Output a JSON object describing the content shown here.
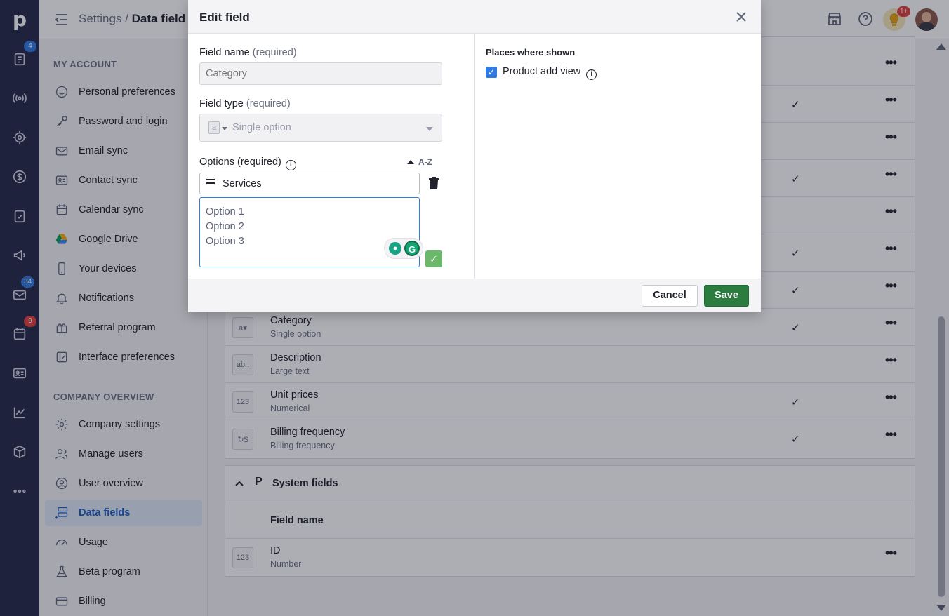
{
  "rail": {
    "logo": "p",
    "badges": {
      "deals": "4",
      "mail": "34",
      "activities": "9"
    },
    "colors": {
      "background": "#262847",
      "badge_blue": "#317ae2",
      "badge_red": "#e0403c"
    }
  },
  "header": {
    "breadcrumb_parent": "Settings",
    "breadcrumb_sep": " / ",
    "breadcrumb_current": "Data field",
    "notification_badge": "1+"
  },
  "sidebar": {
    "my_account_heading": "MY ACCOUNT",
    "my_account": [
      {
        "label": "Personal preferences",
        "icon": "smile-icon"
      },
      {
        "label": "Password and login",
        "icon": "key-icon"
      },
      {
        "label": "Email sync",
        "icon": "mail-icon"
      },
      {
        "label": "Contact sync",
        "icon": "contact-card-icon"
      },
      {
        "label": "Calendar sync",
        "icon": "calendar-icon"
      },
      {
        "label": "Google Drive",
        "icon": "google-drive-icon"
      },
      {
        "label": "Your devices",
        "icon": "phone-icon"
      },
      {
        "label": "Notifications",
        "icon": "bell-icon"
      },
      {
        "label": "Referral program",
        "icon": "gift-icon"
      },
      {
        "label": "Interface preferences",
        "icon": "interface-icon"
      }
    ],
    "company_heading": "COMPANY OVERVIEW",
    "company": [
      {
        "label": "Company settings",
        "icon": "gear-icon"
      },
      {
        "label": "Manage users",
        "icon": "users-icon"
      },
      {
        "label": "User overview",
        "icon": "user-circle-icon"
      },
      {
        "label": "Data fields",
        "icon": "data-fields-icon",
        "active": true
      },
      {
        "label": "Usage",
        "icon": "gauge-icon"
      },
      {
        "label": "Beta program",
        "icon": "flask-icon"
      },
      {
        "label": "Billing",
        "icon": "credit-card-icon"
      }
    ]
  },
  "fields": {
    "rows": [
      {
        "name": "Category",
        "type": "Single option",
        "icon": "a▾",
        "checked": true
      },
      {
        "name": "Description",
        "type": "Large text",
        "icon": "ab..",
        "checked": false
      },
      {
        "name": "Unit prices",
        "type": "Numerical",
        "icon": "123",
        "checked": true
      },
      {
        "name": "Billing frequency",
        "type": "Billing frequency",
        "icon": "↻$",
        "checked": true
      }
    ],
    "system_title": "System fields",
    "system_header": "Field name",
    "system_rows": [
      {
        "name": "ID",
        "type": "Number",
        "icon": "123"
      }
    ],
    "check_mark": "✓",
    "dots": "•••"
  },
  "modal": {
    "title": "Edit field",
    "field_name_label": "Field name",
    "required": "(required)",
    "field_name_placeholder": "Category",
    "field_type_label": "Field type",
    "field_type_value": "Single option",
    "field_type_icon": "a",
    "options_label": "Options (required)",
    "sort_label": "A-Z",
    "option_name_value": "Services",
    "option_lines": [
      "Option 1",
      "Option 2",
      "Option 3"
    ],
    "places_heading": "Places where shown",
    "place_product_add_view": "Product add view",
    "place_checked": true,
    "cancel_label": "Cancel",
    "save_label": "Save",
    "colors": {
      "save": "#2a7d3f",
      "checkbox": "#317ae2",
      "confirm": "#6bb86a"
    }
  }
}
